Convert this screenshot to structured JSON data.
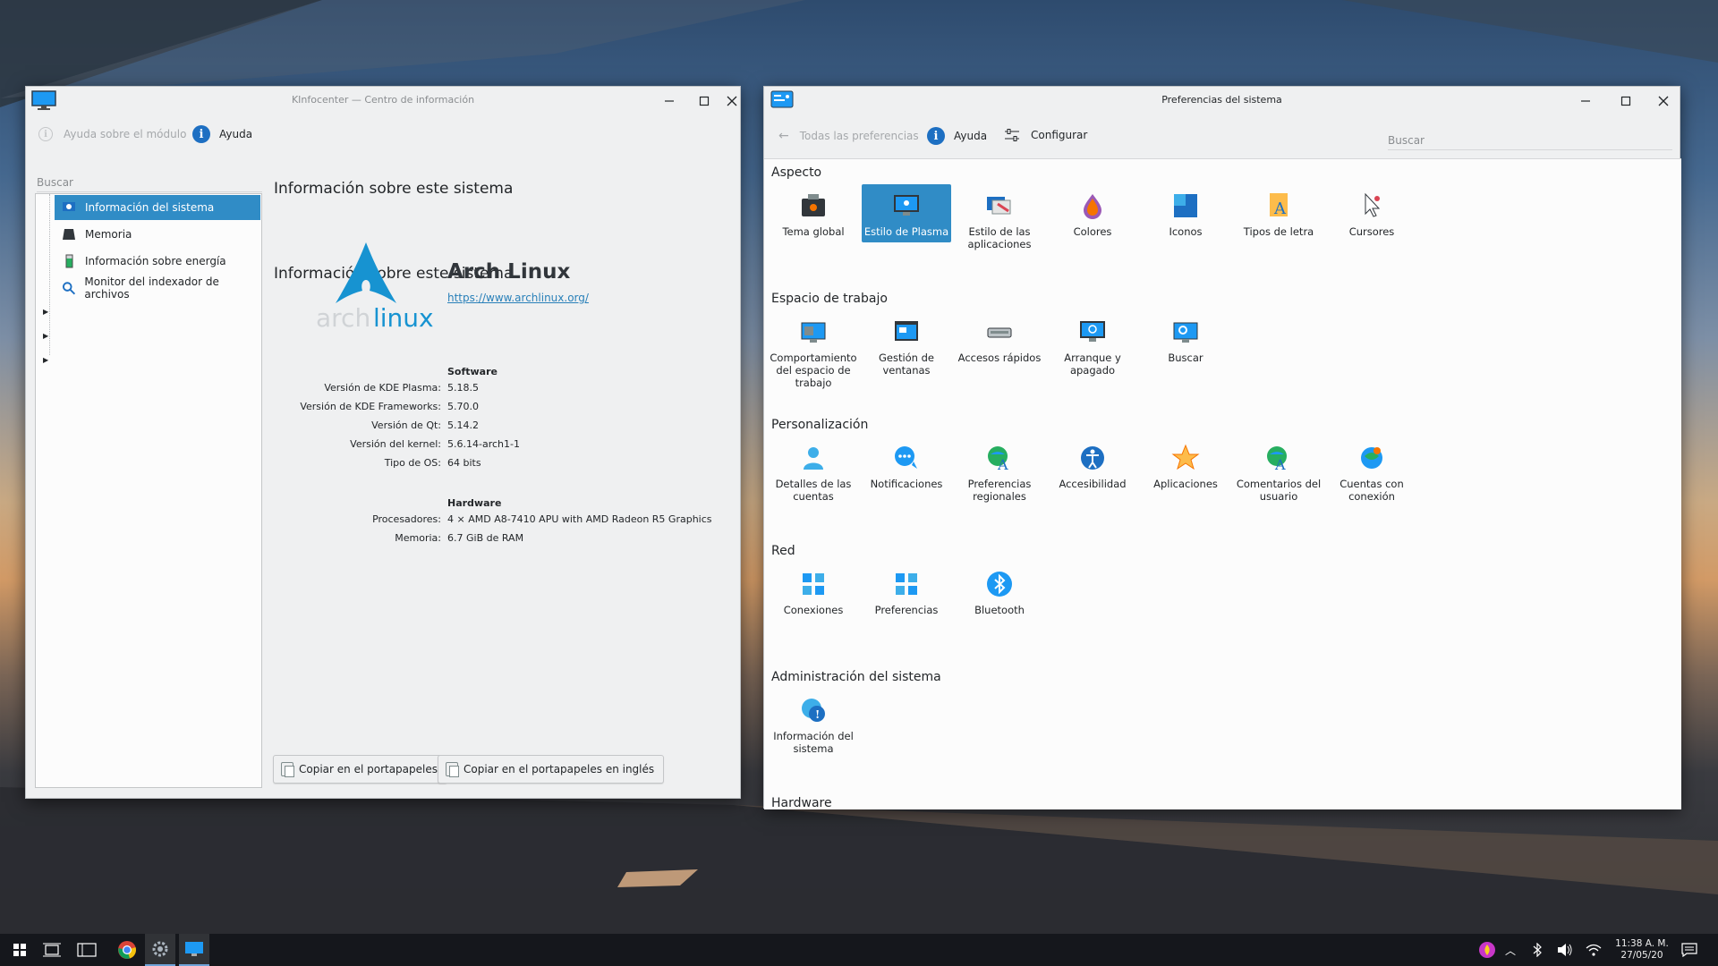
{
  "kinfocenter": {
    "title": "KInfocenter — Centro de información",
    "toolbar": {
      "module_help": "Ayuda sobre el módulo",
      "help": "Ayuda"
    },
    "search_placeholder": "Buscar",
    "sidebar": [
      {
        "label": "Información del sistema",
        "icon": "system-info-icon",
        "selected": true
      },
      {
        "label": "Memoria",
        "icon": "memory-icon",
        "selected": false
      },
      {
        "label": "Información sobre energía",
        "icon": "battery-icon",
        "selected": false
      },
      {
        "label": "Monitor del indexador de archivos",
        "icon": "magnifier-icon",
        "selected": false
      }
    ],
    "heading": "Información sobre este sistema",
    "logo_text": "archlinux",
    "os_name": "Arch Linux",
    "os_url": "https://www.archlinux.org/",
    "software": {
      "label": "Software",
      "rows": [
        {
          "k": "Versión de KDE Plasma:",
          "v": "5.18.5"
        },
        {
          "k": "Versión de KDE Frameworks:",
          "v": "5.70.0"
        },
        {
          "k": "Versión de Qt:",
          "v": "5.14.2"
        },
        {
          "k": "Versión del kernel:",
          "v": "5.6.14-arch1-1"
        },
        {
          "k": "Tipo de OS:",
          "v": "64 bits"
        }
      ]
    },
    "hardware": {
      "label": "Hardware",
      "rows": [
        {
          "k": "Procesadores:",
          "v": "4 × AMD A8-7410 APU with AMD Radeon R5 Graphics"
        },
        {
          "k": "Memoria:",
          "v": "6.7 GiB de RAM"
        }
      ]
    },
    "buttons": {
      "copy": "Copiar en el portapapeles",
      "copy_en": "Copiar en el portapapeles en inglés"
    }
  },
  "prefs": {
    "title": "Preferencias del sistema",
    "toolbar": {
      "all": "Todas las preferencias",
      "help": "Ayuda",
      "configure": "Configurar"
    },
    "search_placeholder": "Buscar",
    "categories": [
      {
        "title": "Aspecto",
        "items": [
          "Tema global",
          "Estilo de Plasma",
          "Estilo de las aplicaciones",
          "Colores",
          "Iconos",
          "Tipos de letra",
          "Cursores"
        ]
      },
      {
        "title": "Espacio de trabajo",
        "items": [
          "Comportamiento del espacio de trabajo",
          "Gestión de ventanas",
          "Accesos rápidos",
          "Arranque y apagado",
          "Buscar"
        ]
      },
      {
        "title": "Personalización",
        "items": [
          "Detalles de las cuentas",
          "Notificaciones",
          "Preferencias regionales",
          "Accesibilidad",
          "Aplicaciones",
          "Comentarios del usuario",
          "Cuentas con conexión"
        ]
      },
      {
        "title": "Red",
        "items": [
          "Conexiones",
          "Preferencias",
          "Bluetooth"
        ]
      },
      {
        "title": "Administración del sistema",
        "items": [
          "Información del sistema"
        ]
      },
      {
        "title": "Hardware",
        "items": []
      }
    ],
    "selected_item": "Estilo de Plasma"
  },
  "taskbar": {
    "clock_time": "11:38 A. M.",
    "clock_date": "27/05/20",
    "apps": [
      "start-menu-icon",
      "task-view-icon",
      "desktop-icon",
      "chrome-icon",
      "settings-app-icon",
      "kinfocenter-app-icon"
    ],
    "tray": [
      "notification-app-icon",
      "tray-expand-icon",
      "bluetooth-icon",
      "volume-icon",
      "wifi-icon",
      "action-center-icon"
    ]
  },
  "colors": {
    "accent": "#308cc6",
    "arch_blue": "#1793d1",
    "link": "#2980b9"
  }
}
